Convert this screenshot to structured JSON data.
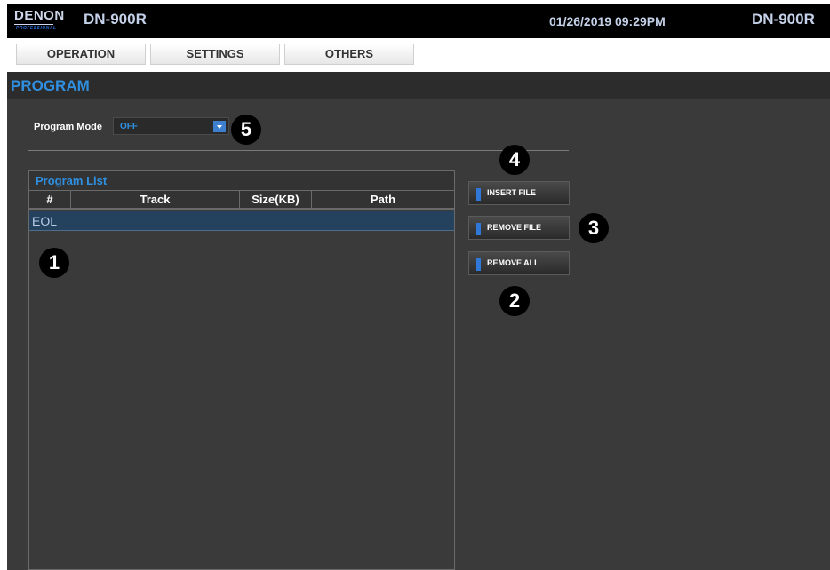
{
  "header": {
    "logo_text": "DENON",
    "logo_subtext": "PROFESSIONAL",
    "model_left": "DN-900R",
    "datetime": "01/26/2019 09:29PM",
    "model_right": "DN-900R"
  },
  "menu": {
    "items": [
      {
        "label": "OPERATION"
      },
      {
        "label": "SETTINGS"
      },
      {
        "label": "OTHERS"
      }
    ]
  },
  "page": {
    "title": "PROGRAM",
    "program_mode": {
      "label": "Program Mode",
      "value": "OFF",
      "arrow_icon": "chevron-down-icon"
    }
  },
  "program_list": {
    "title": "Program List",
    "columns": [
      "#",
      "Track",
      "Size(KB)",
      "Path"
    ],
    "rows": [
      {
        "label": "EOL"
      }
    ]
  },
  "actions": {
    "insert_file": "INSERT FILE",
    "remove_file": "REMOVE FILE",
    "remove_all": "REMOVE ALL"
  },
  "callouts": [
    "1",
    "2",
    "3",
    "4",
    "5"
  ],
  "colors": {
    "accent_blue": "#2f8fe0",
    "header_bg": "#000000",
    "panel_bg": "#3a3a3a",
    "selected_row": "#24415e"
  }
}
